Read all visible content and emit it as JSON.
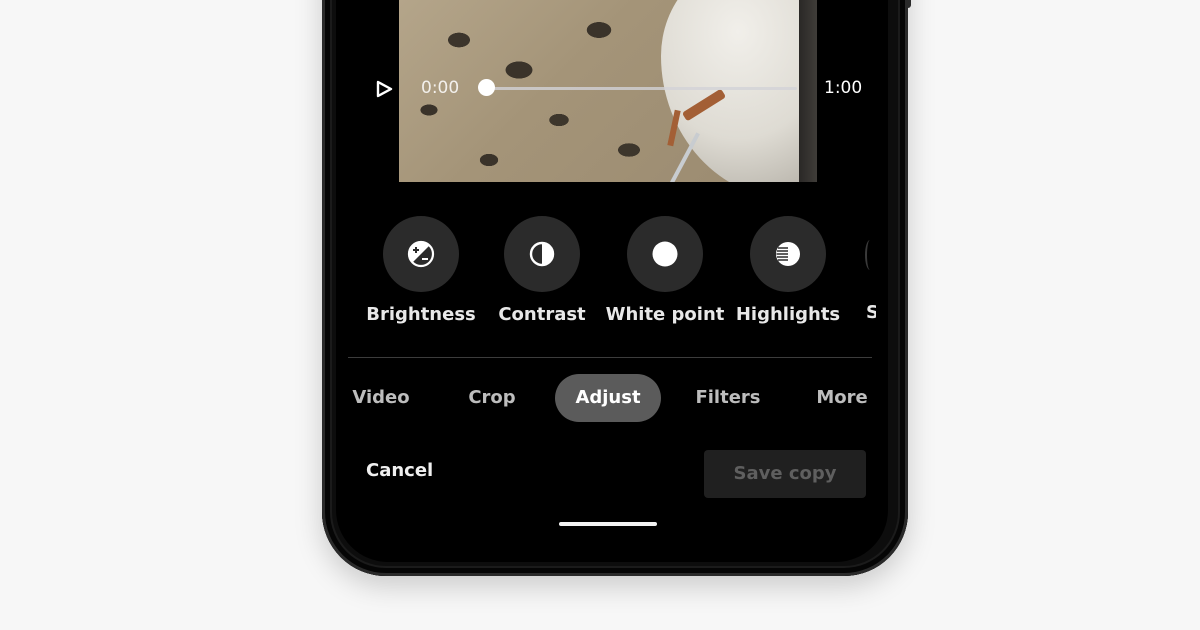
{
  "video_player": {
    "play_icon": "play-triangle-outline",
    "current_time": "0:00",
    "duration": "1:00",
    "progress_fraction": 0.0
  },
  "adjust_tools": [
    {
      "label": "Brightness",
      "icon": "brightness-icon"
    },
    {
      "label": "Contrast",
      "icon": "contrast-icon"
    },
    {
      "label": "White point",
      "icon": "white-point-icon"
    },
    {
      "label": "Highlights",
      "icon": "highlights-icon"
    },
    {
      "label": "S",
      "icon": "partial-tool-icon"
    }
  ],
  "tabs": [
    {
      "label": "Video",
      "active": false
    },
    {
      "label": "Crop",
      "active": false
    },
    {
      "label": "Adjust",
      "active": true
    },
    {
      "label": "Filters",
      "active": false
    },
    {
      "label": "More",
      "active": false
    }
  ],
  "actions": {
    "cancel_label": "Cancel",
    "save_label": "Save copy",
    "save_enabled": false
  },
  "colors": {
    "tool_circle": "#2b2b2b",
    "active_tab": "#5b5b5b",
    "save_disabled_bg": "#202020"
  }
}
